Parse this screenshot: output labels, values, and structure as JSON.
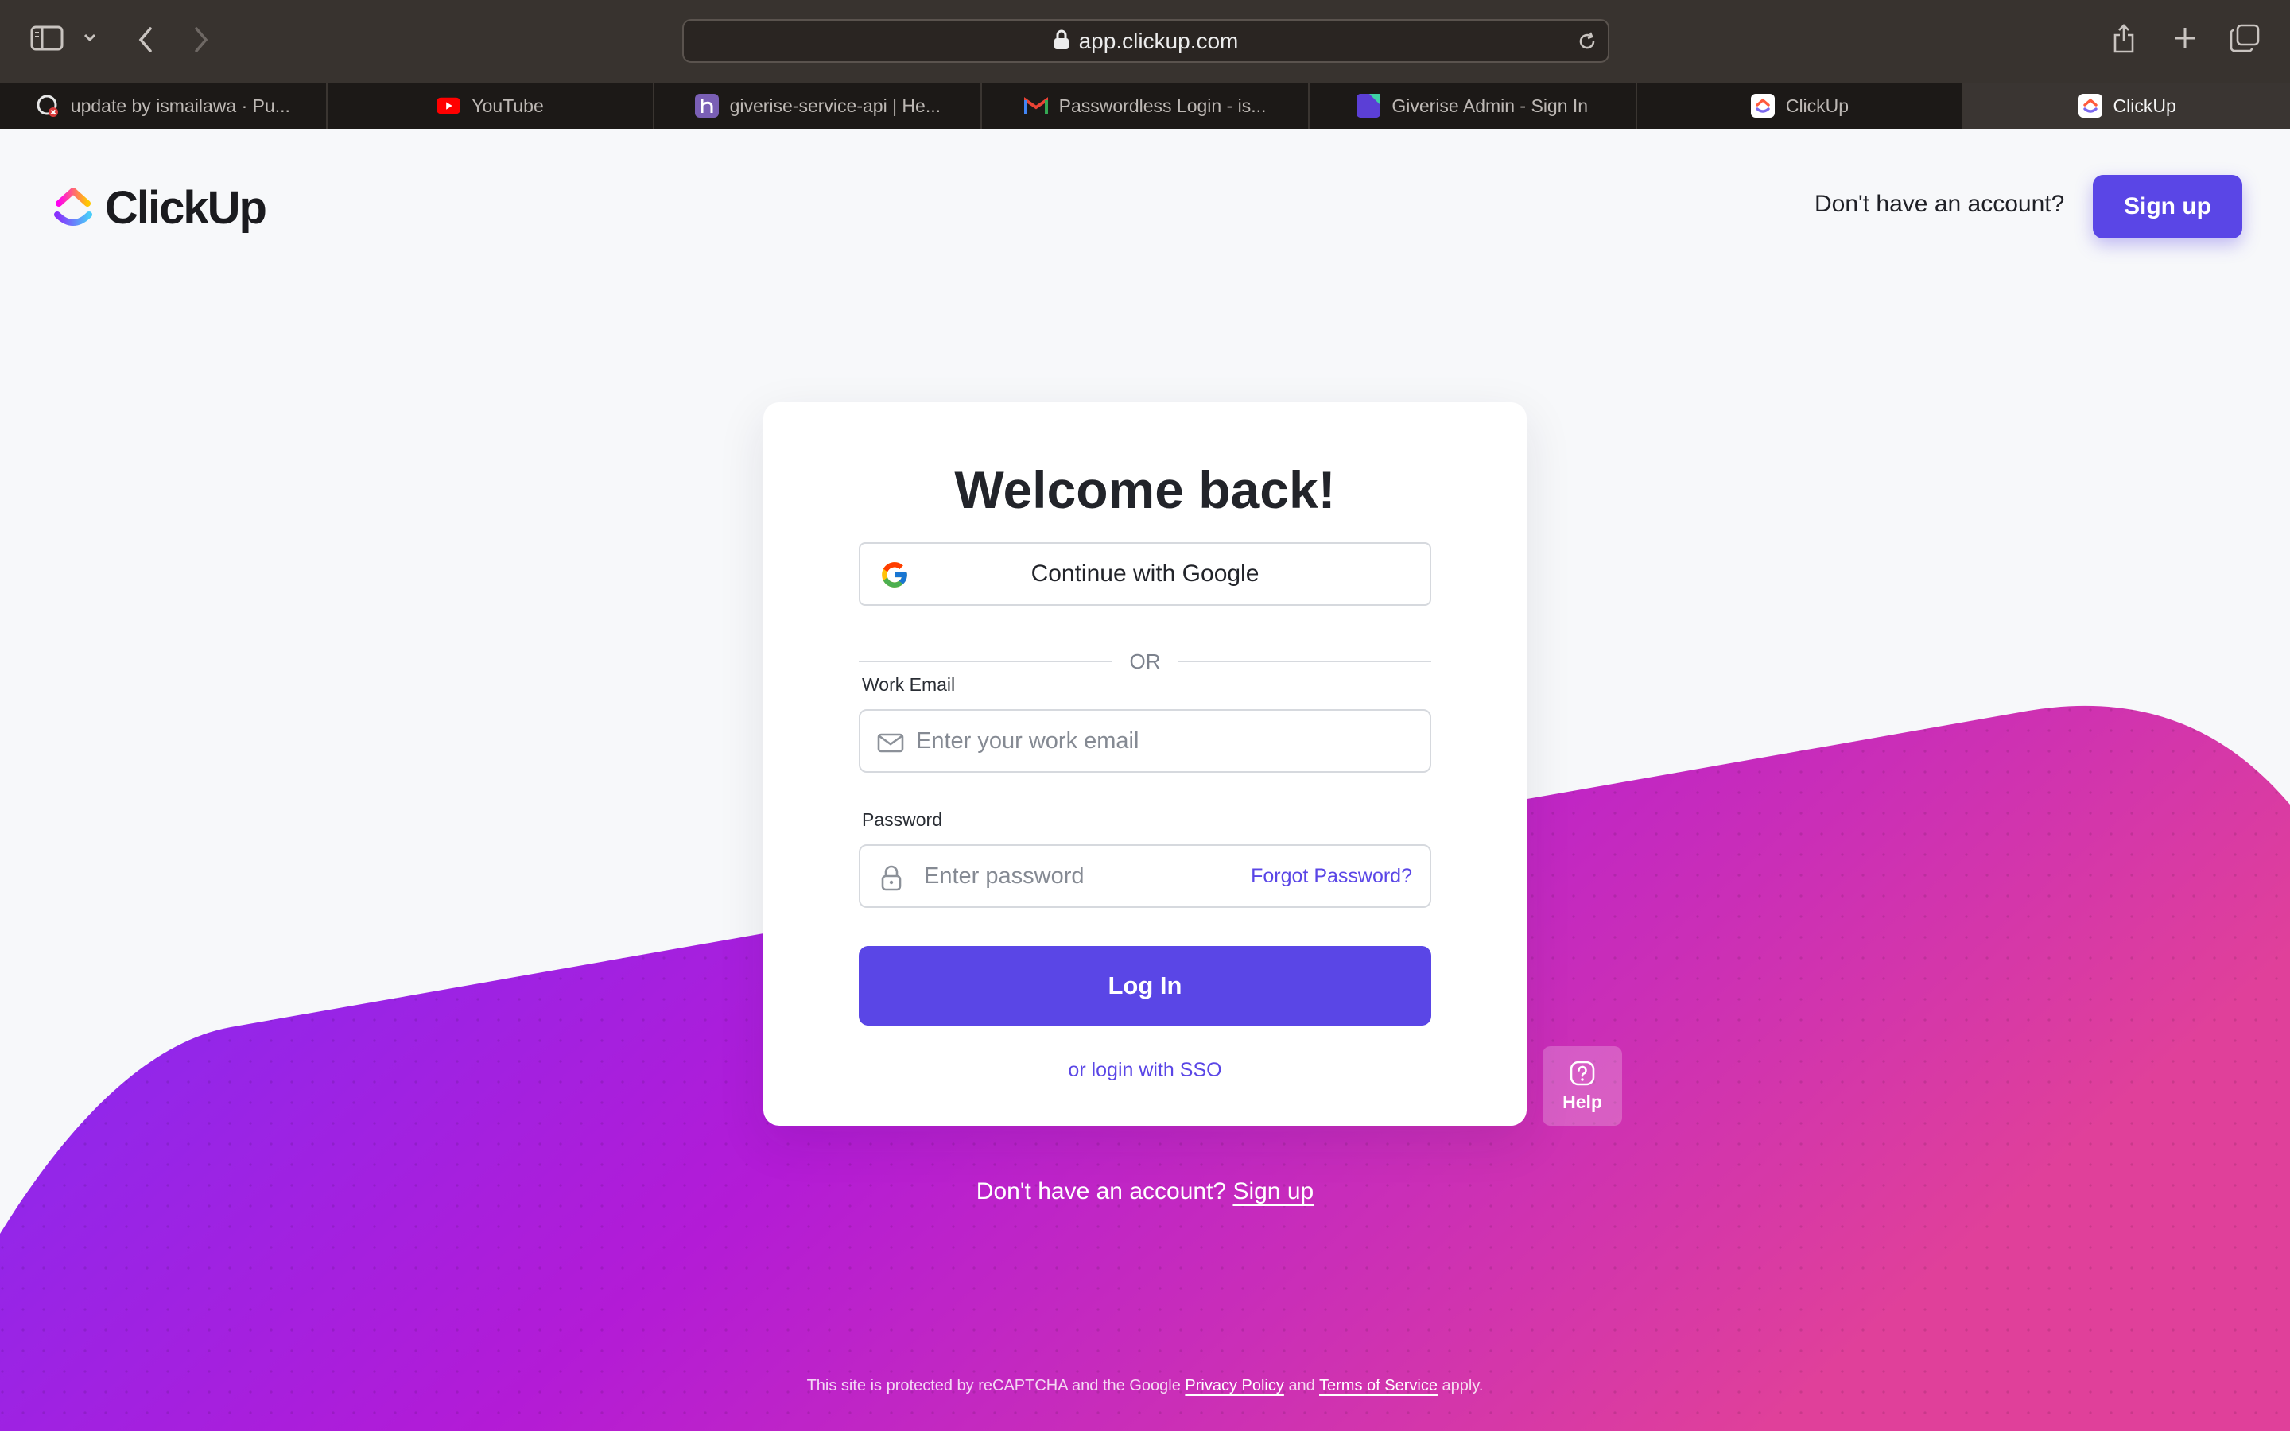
{
  "browser": {
    "url": "app.clickup.com",
    "tabs": [
      {
        "label": "update by ismailawa · Pu...",
        "icon": "github-actions-icon",
        "active": false
      },
      {
        "label": "YouTube",
        "icon": "youtube-icon",
        "active": false
      },
      {
        "label": "giverise-service-api | He...",
        "icon": "heroku-icon",
        "active": false
      },
      {
        "label": "Passwordless Login - is...",
        "icon": "gmail-icon",
        "active": false
      },
      {
        "label": "Giverise Admin - Sign In",
        "icon": "giverise-icon",
        "active": false
      },
      {
        "label": "ClickUp",
        "icon": "clickup-icon",
        "active": false
      },
      {
        "label": "ClickUp",
        "icon": "clickup-icon",
        "active": true
      }
    ]
  },
  "header": {
    "brand": "ClickUp",
    "prompt": "Don't have an account?",
    "signup_label": "Sign up"
  },
  "login": {
    "title": "Welcome back!",
    "google_label": "Continue with Google",
    "or_label": "OR",
    "email_label": "Work Email",
    "email_placeholder": "Enter your work email",
    "password_label": "Password",
    "password_placeholder": "Enter password",
    "forgot_label": "Forgot Password?",
    "login_label": "Log In",
    "sso_label": "or login with SSO"
  },
  "help": {
    "label": "Help"
  },
  "bottom": {
    "prompt": "Don't have an account?",
    "signup_link": "Sign up"
  },
  "footer": {
    "prefix": "This site is protected by reCAPTCHA and the Google",
    "privacy": "Privacy Policy",
    "and": "and",
    "terms": "Terms of Service",
    "suffix": "apply."
  },
  "colors": {
    "accent": "#5a46e6",
    "wave_start": "#7b2ff7",
    "wave_mid": "#b31bd6",
    "wave_end": "#e0409a"
  }
}
